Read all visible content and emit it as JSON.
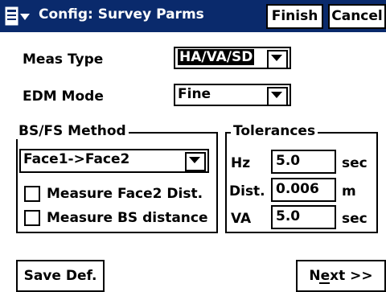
{
  "title_bar": {
    "title": "Config: Survey Parms",
    "finish_label": "Finish",
    "cancel_label": "Cancel",
    "background": "#0a2a6c"
  },
  "meas_type": {
    "label": "Meas Type",
    "value": "HA/VA/SD"
  },
  "edm_mode": {
    "label": "EDM Mode",
    "value": "Fine"
  },
  "bs_fs_method": {
    "title": "BS/FS Method",
    "value": "Face1->Face2",
    "checkboxes": [
      {
        "label": "Measure Face2 Dist.",
        "checked": false
      },
      {
        "label": "Measure BS distance",
        "checked": false
      }
    ]
  },
  "tolerances": {
    "title": "Tolerances",
    "rows": [
      {
        "label": "Hz",
        "value": "5.0",
        "unit": "sec"
      },
      {
        "label": "Dist.",
        "value": "0.006",
        "unit": "m"
      },
      {
        "label": "VA",
        "value": "5.0",
        "unit": "sec"
      }
    ]
  },
  "footer": {
    "save_def_label": "Save Def.",
    "next_label": "Next >>"
  }
}
